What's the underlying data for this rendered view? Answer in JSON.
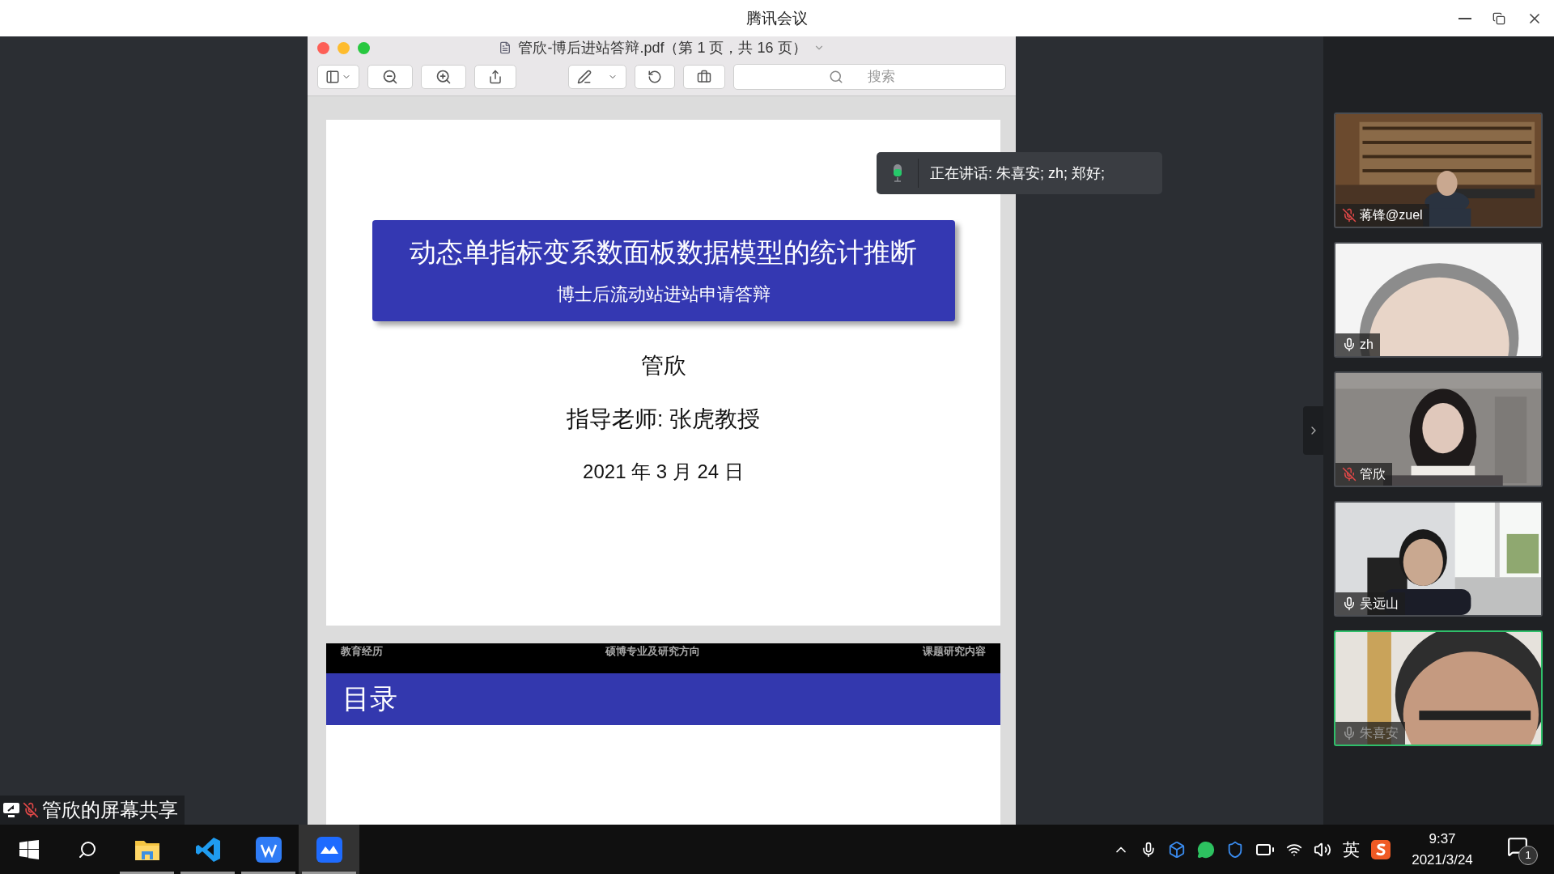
{
  "window": {
    "title": "腾讯会议"
  },
  "pdf_viewer": {
    "title": "管欣-博后进站答辩.pdf（第 1 页，共 16 页）",
    "search": {
      "placeholder": "搜索"
    }
  },
  "slide_1": {
    "title": "动态单指标变系数面板数据模型的统计推断",
    "subtitle": "博士后流动站进站申请答辩",
    "author": "管欣",
    "advisor": "指导老师: 张虎教授",
    "date": "2021 年 3 月 24 日"
  },
  "slide_2": {
    "nav": [
      "教育经历",
      "硕博专业及研究方向",
      "课题研究内容"
    ],
    "heading": "目录"
  },
  "speaking_toast": {
    "text": "正在讲话: 朱喜安; zh; 郑好;"
  },
  "participants": [
    {
      "name": "蒋锋@zuel",
      "muted": true,
      "active": false
    },
    {
      "name": "zh",
      "muted": false,
      "active": false
    },
    {
      "name": "管欣",
      "muted": true,
      "active": false
    },
    {
      "name": "吴远山",
      "muted": false,
      "active": false
    },
    {
      "name": "朱喜安",
      "muted": false,
      "active": true
    }
  ],
  "screen_share_label": {
    "text": "管欣的屏幕共享"
  },
  "taskbar": {
    "apps": [
      {
        "kind": "folder",
        "selected": false
      },
      {
        "kind": "code",
        "selected": false
      },
      {
        "kind": "writer",
        "selected": false
      },
      {
        "kind": "meeting",
        "selected": true
      }
    ],
    "tray": {
      "ime": "英",
      "time": "9:37",
      "date": "2021/3/24",
      "notifications": "1"
    }
  }
}
